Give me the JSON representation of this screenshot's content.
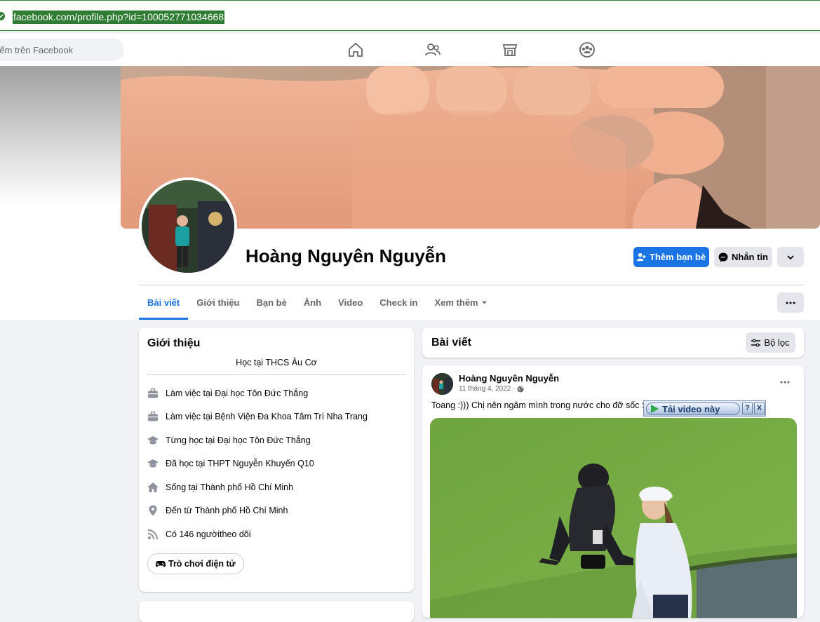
{
  "browser": {
    "url": "facebook.com/profile.php?id=100052771034668"
  },
  "topnav": {
    "search_placeholder": "Tìm kiếm trên Facebook",
    "search_visible": "kiếm trên Facebook"
  },
  "profile": {
    "name": "Hoàng Nguyên Nguyễn",
    "add_friend_label": "Thêm bạn bè",
    "message_label": "Nhắn tin"
  },
  "tabs": [
    {
      "label": "Bài viết"
    },
    {
      "label": "Giới thiệu"
    },
    {
      "label": "Bạn bè"
    },
    {
      "label": "Ảnh"
    },
    {
      "label": "Video"
    },
    {
      "label": "Check in"
    },
    {
      "label": "Xem thêm"
    }
  ],
  "intro": {
    "title": "Giới thiệu",
    "bio": "Học tại THCS Âu Cơ",
    "rows": [
      {
        "prefix": "Làm việc tại ",
        "value": "Đại học Tôn Đức Thắng",
        "icon": "briefcase-icon"
      },
      {
        "prefix": "Làm việc tại ",
        "value": "Bệnh Viện Đa Khoa Tâm Trí Nha Trang",
        "icon": "briefcase-icon"
      },
      {
        "prefix": "Từng học tại ",
        "value": "Đại học Tôn Đức Thắng",
        "icon": "graduation-cap-icon"
      },
      {
        "prefix": "Đã học tại ",
        "value": "THPT Nguyễn Khuyến Q10",
        "icon": "graduation-cap-icon"
      },
      {
        "prefix": "Sống tại ",
        "value": "Thành phố Hồ Chí Minh",
        "icon": "home-icon"
      },
      {
        "prefix": "Đến từ ",
        "value": "Thành phố Hồ Chí Minh",
        "icon": "location-pin-icon"
      },
      {
        "prefix": "Có ",
        "value": "146 người",
        "suffix": " theo dõi",
        "icon": "rss-icon"
      }
    ],
    "games_button": "Trò chơi điện tử"
  },
  "posts_header": {
    "title": "Bài viết",
    "filter_label": "Bộ lọc"
  },
  "post": {
    "author": "Hoàng Nguyên Nguyễn",
    "date": "11 tháng 4, 2022 ·",
    "text": "Toang :))) Chị nên ngâm mình trong nước cho đỡ sốc :))"
  },
  "download_overlay": {
    "label": "Tải video này",
    "help": "?",
    "close": "X"
  },
  "colors": {
    "accent": "#1b74e4",
    "address_highlight": "#2e7d32"
  }
}
